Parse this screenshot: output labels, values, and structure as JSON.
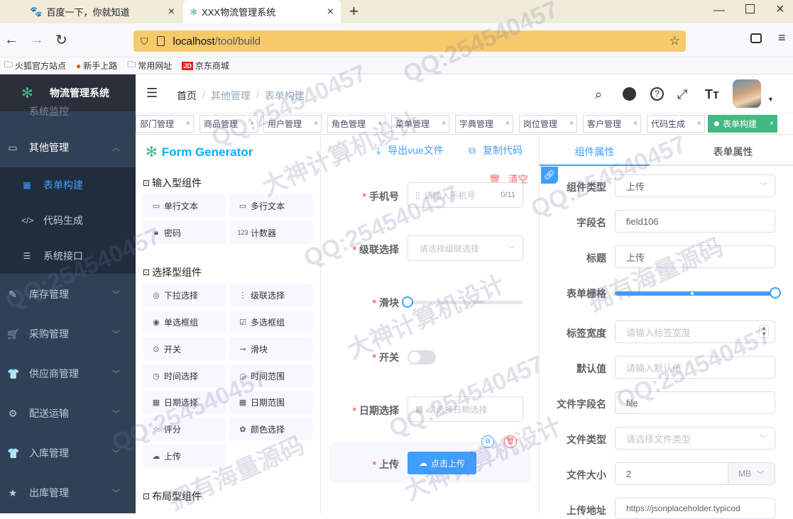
{
  "browser": {
    "tabs": [
      {
        "title": "百度一下，你就知道"
      },
      {
        "title": "XXX物流管理系统"
      }
    ],
    "new_tab": "+",
    "url_host": "localhost",
    "url_path": "/tool/build",
    "bookmarks": [
      "火狐官方站点",
      "新手上路",
      "常用网址",
      "京东商城"
    ],
    "bookmark_jd_badge": "JD"
  },
  "sidebar": {
    "brand": "物流管理系统",
    "partial_top": "系统监控",
    "items": [
      {
        "label": "其他管理",
        "icon": "briefcase-icon",
        "expanded": true
      },
      {
        "label": "库存管理",
        "icon": "edit-icon"
      },
      {
        "label": "采购管理",
        "icon": "cart-icon"
      },
      {
        "label": "供应商管理",
        "icon": "shirt-icon"
      },
      {
        "label": "配送运输",
        "icon": "gear-icon"
      },
      {
        "label": "入库管理",
        "icon": "shirt-icon"
      },
      {
        "label": "出库管理",
        "icon": "star-icon"
      }
    ],
    "sub_items": [
      {
        "label": "表单构建",
        "icon": "table-icon",
        "active": true
      },
      {
        "label": "代码生成",
        "icon": "code-icon"
      },
      {
        "label": "系统接口",
        "icon": "sliders-icon"
      }
    ]
  },
  "header": {
    "breadcrumb": [
      "首页",
      "其他管理",
      "表单构建"
    ],
    "breadcrumb_sep": "/",
    "icons": [
      "search-icon",
      "github-icon",
      "question-icon",
      "fullscreen-icon",
      "font-size-icon"
    ]
  },
  "tags": [
    {
      "label": "部门管理"
    },
    {
      "label": "商品管理"
    },
    {
      "label": "用户管理"
    },
    {
      "label": "角色管理"
    },
    {
      "label": "菜单管理"
    },
    {
      "label": "字典管理"
    },
    {
      "label": "岗位管理"
    },
    {
      "label": "客户管理"
    },
    {
      "label": "代码生成"
    },
    {
      "label": "表单构建",
      "active": true
    }
  ],
  "tag_close": "×",
  "generator": {
    "title": "Form Generator",
    "export_label": "导出vue文件",
    "copy_label": "复制代码",
    "clear_label": "清空",
    "groups": [
      {
        "title": "输入型组件",
        "items": [
          {
            "label": "单行文本",
            "icon": "input-icon"
          },
          {
            "label": "多行文本",
            "icon": "textarea-icon"
          },
          {
            "label": "密码",
            "icon": "lock-icon"
          },
          {
            "label": "计数器",
            "icon": "number-icon"
          }
        ]
      },
      {
        "title": "选择型组件",
        "items": [
          {
            "label": "下拉选择",
            "icon": "select-icon"
          },
          {
            "label": "级联选择",
            "icon": "cascader-icon"
          },
          {
            "label": "单选框组",
            "icon": "radio-icon"
          },
          {
            "label": "多选框组",
            "icon": "checkbox-icon"
          },
          {
            "label": "开关",
            "icon": "switch-icon"
          },
          {
            "label": "滑块",
            "icon": "slider-icon"
          },
          {
            "label": "时间选择",
            "icon": "clock-icon"
          },
          {
            "label": "时间范围",
            "icon": "time-range-icon"
          },
          {
            "label": "日期选择",
            "icon": "calendar-icon"
          },
          {
            "label": "日期范围",
            "icon": "date-range-icon"
          },
          {
            "label": "评分",
            "icon": "star-outline-icon"
          },
          {
            "label": "颜色选择",
            "icon": "palette-icon"
          },
          {
            "label": "上传",
            "icon": "upload-icon"
          }
        ]
      },
      {
        "title": "布局型组件",
        "items": []
      }
    ],
    "icon_number_glyph": "123"
  },
  "form": {
    "fields": [
      {
        "label": "手机号",
        "placeholder": "请输入手机号",
        "counter": "0/11"
      },
      {
        "label": "级联选择",
        "placeholder": "请选择级联选择"
      },
      {
        "label": "滑块",
        "slider_value": 0
      },
      {
        "label": "开关",
        "switch_on": false
      },
      {
        "label": "日期选择",
        "placeholder": "请选择日期选择"
      },
      {
        "label": "上传",
        "button_label": "点击上传"
      }
    ]
  },
  "props": {
    "tabs": [
      "组件属性",
      "表单属性"
    ],
    "rows": [
      {
        "label": "组件类型",
        "value": "上传",
        "kind": "select"
      },
      {
        "label": "字段名",
        "value": "field106"
      },
      {
        "label": "标题",
        "value": "上传"
      },
      {
        "label": "表单栅格",
        "kind": "slider",
        "fraction": 1.0
      },
      {
        "label": "标签宽度",
        "placeholder": "请输入标签宽度",
        "kind": "number"
      },
      {
        "label": "默认值",
        "placeholder": "请输入默认值"
      },
      {
        "label": "文件字段名",
        "value": "file"
      },
      {
        "label": "文件类型",
        "placeholder": "请选择文件类型",
        "kind": "select"
      },
      {
        "label": "文件大小",
        "value": "2",
        "unit": "MB"
      },
      {
        "label": "上传地址",
        "value": "https://jsonplaceholder.typicod"
      }
    ]
  },
  "watermark": [
    "QQ:254540457",
    "大神计算机设计",
    "拥有海量源码"
  ],
  "colors": {
    "sidebar_bg": "#304156",
    "sidebar_sub_bg": "#1f2d3d",
    "sidebar_active": "#409eff",
    "accent": "#409eff",
    "tag_active": "#42b983",
    "danger": "#f56c6c",
    "brand_green": "#41b883"
  }
}
